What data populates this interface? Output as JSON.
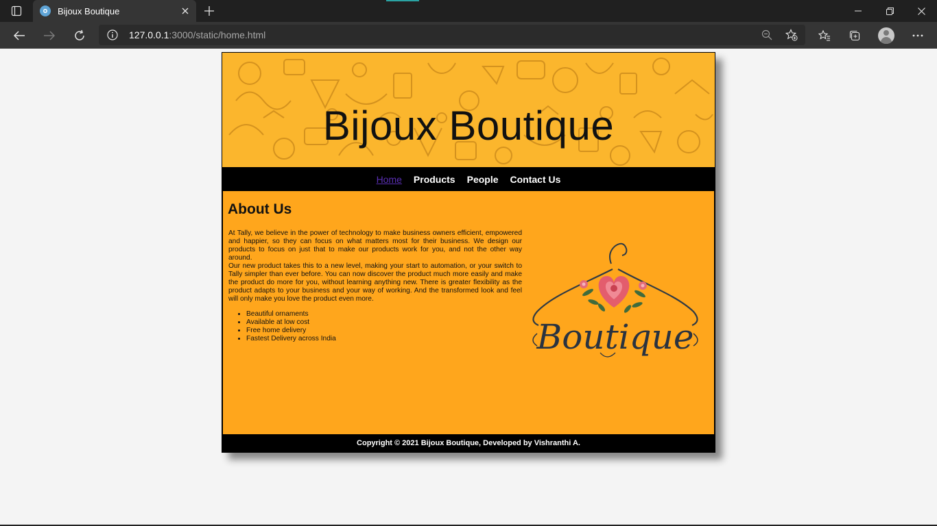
{
  "browser": {
    "tab_title": "Bijoux Boutique",
    "url_host": "127.0.0.1",
    "url_rest": ":3000/static/home.html",
    "accent_color": "#2aa3a3",
    "icons": [
      "tab-actions-icon",
      "site-favicon",
      "close-icon",
      "plus-icon",
      "minimize-icon",
      "restore-icon",
      "close-window-icon",
      "back-arrow-icon",
      "forward-arrow-icon",
      "refresh-icon",
      "info-icon",
      "zoom-out-icon",
      "add-favorite-icon",
      "favorites-icon",
      "collections-icon",
      "profile-avatar",
      "more-icon"
    ]
  },
  "site": {
    "title": "Bijoux Boutique",
    "nav": {
      "home": "Home",
      "products": "Products",
      "people": "People",
      "contact": "Contact Us"
    },
    "about": {
      "heading": "About Us",
      "paragraph1": "At Tally, we believe in the power of technology to make business owners efficient, empowered and happier, so they can focus on what matters most for their business. We design our products to focus on just that to make our products work for you, and not the other way around.",
      "paragraph2": "Our new product takes this to a new level, making your start to automation, or your switch to Tally simpler than ever before. You can now discover the product much more easily and make the product do more for you, without learning anything new. There is greater flexibility as the product adapts to your business and your way of working. And the transformed look and feel will only make you love the product even more.",
      "features": [
        "Beautiful ornaments",
        "Available at low cost",
        "Free home delivery",
        "Fastest Delivery across India"
      ]
    },
    "logo_text": "Boutique",
    "footer": "Copyright © 2021 Bijoux Boutique, Developed by Vishranthi A.",
    "colors": {
      "banner": "#fbb62d",
      "content": "#ffa61c",
      "nav_bg": "#000000",
      "active_link": "#5a2fb4"
    }
  }
}
